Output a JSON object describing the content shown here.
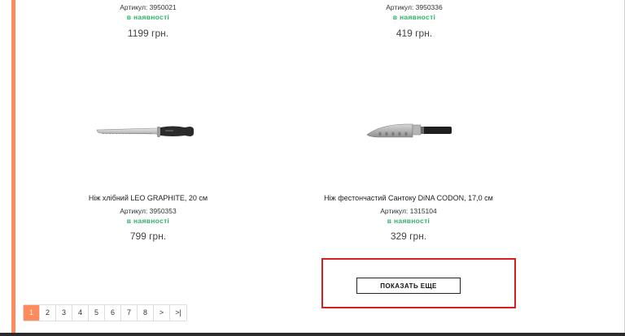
{
  "products_top": [
    {
      "sku": "Артикул: 3950021",
      "stock": "в наявності",
      "price": "1199 грн."
    },
    {
      "sku": "Артикул: 3950336",
      "stock": "в наявності",
      "price": "419 грн."
    }
  ],
  "products": [
    {
      "name": "Ніж хлібний LEO GRAPHITE, 20 см",
      "sku": "Артикул: 3950353",
      "stock": "в наявності",
      "price": "799 грн.",
      "image": "bread-knife-image"
    },
    {
      "name": "Ніж фестончастий Сантоку DiNA CODON, 17,0 см",
      "sku": "Артикул: 1315104",
      "stock": "в наявності",
      "price": "329 грн.",
      "image": "santoku-knife-image"
    }
  ],
  "load_more_label": "ПОКАЗАТЬ ЕЩЕ",
  "pagination": {
    "pages": [
      "1",
      "2",
      "3",
      "4",
      "5",
      "6",
      "7",
      "8"
    ],
    "active": "1",
    "next_label": ">",
    "last_label": ">|"
  },
  "colors": {
    "accent": "#ff8a5b",
    "in_stock": "#2fb36b",
    "highlight_frame": "#d62020"
  }
}
